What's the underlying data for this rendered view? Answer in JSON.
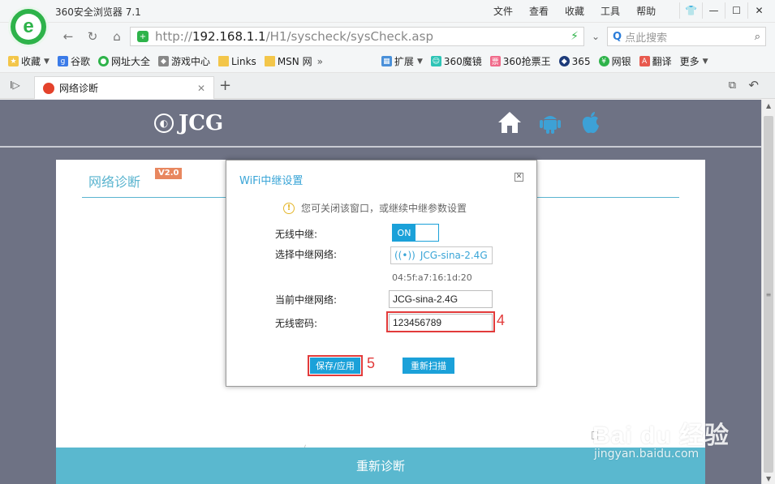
{
  "browser": {
    "title": "360安全浏览器 7.1",
    "menu": [
      "文件",
      "查看",
      "收藏",
      "工具",
      "帮助"
    ],
    "url_prefix": "http://",
    "url_host": "192.168.1.1",
    "url_path": "/H1/syscheck/sysCheck.asp",
    "search_placeholder": "点此搜索",
    "bookmarks": [
      "收藏",
      "谷歌",
      "网址大全",
      "游戏中心",
      "Links",
      "MSN 网",
      "扩展",
      "360魔镜",
      "360抢票王",
      "365",
      "网银",
      "翻译",
      "更多"
    ],
    "tab_title": "网络诊断"
  },
  "page": {
    "brand": "JCG",
    "card_title": "网络诊断",
    "version_badge": "V2.0",
    "rediagnose_button": "重新诊断"
  },
  "modal": {
    "title": "WiFi中继设置",
    "notice": "您可关闭该窗口，或继续中继参数设置",
    "labels": {
      "wireless_relay": "无线中继:",
      "select_network": "选择中继网络:",
      "current_network": "当前中继网络:",
      "password": "无线密码:"
    },
    "toggle_state": "ON",
    "selected_network": "JCG-sina-2.4G",
    "mac": "04:5f:a7:16:1d:20",
    "current_network_value": "JCG-sina-2.4G",
    "password_value": "123456789",
    "save_button": "保存/应用",
    "rescan_button": "重新扫描"
  },
  "annotations": {
    "step4": "4",
    "step5": "5"
  },
  "watermark": {
    "brand": "Bai du 经验",
    "url": "jingyan.baidu.com"
  },
  "colors": {
    "accent": "#1ba1d9",
    "header_bg": "#6e7284",
    "highlight": "#e23b3b",
    "title_teal": "#5ab4cf"
  }
}
